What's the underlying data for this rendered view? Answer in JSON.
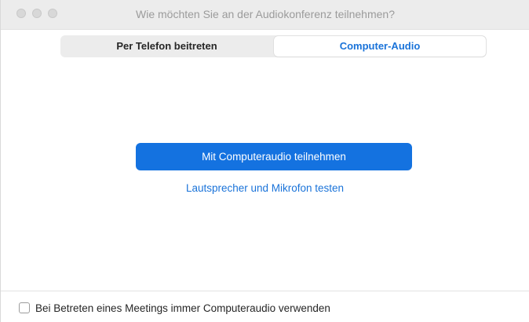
{
  "window": {
    "title": "Wie möchten Sie an der Audiokonferenz teilnehmen?"
  },
  "tabs": [
    {
      "label": "Per Telefon beitreten",
      "selected": false
    },
    {
      "label": "Computer-Audio",
      "selected": true
    }
  ],
  "main": {
    "join_button_label": "Mit Computeraudio teilnehmen",
    "test_link_label": "Lautsprecher und Mikrofon testen"
  },
  "footer": {
    "checkbox_label": "Bei Betreten eines Meetings immer Computeraudio verwenden",
    "checkbox_checked": false
  },
  "colors": {
    "accent": "#1472e0",
    "link": "#1a73d9"
  }
}
